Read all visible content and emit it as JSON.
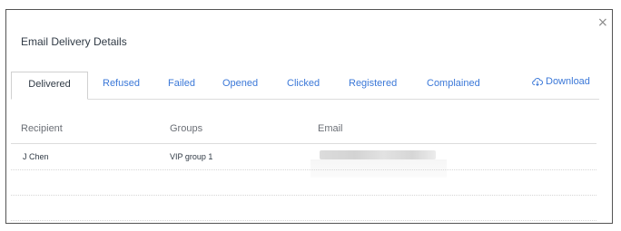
{
  "dialog": {
    "title": "Email Delivery Details",
    "close_label": "×"
  },
  "tabs": [
    {
      "label": "Delivered",
      "active": true
    },
    {
      "label": "Refused"
    },
    {
      "label": "Failed"
    },
    {
      "label": "Opened"
    },
    {
      "label": "Clicked"
    },
    {
      "label": "Registered"
    },
    {
      "label": "Complained"
    }
  ],
  "download": {
    "label": "Download",
    "icon": "cloud-download-icon"
  },
  "table": {
    "columns": [
      "Recipient",
      "Groups",
      "Email"
    ],
    "rows": [
      {
        "recipient": "J Chen",
        "groups": "VIP group 1",
        "email": ""
      }
    ]
  },
  "colors": {
    "link": "#3b78d8",
    "text": "#303a45",
    "border": "#dcdcdc"
  }
}
